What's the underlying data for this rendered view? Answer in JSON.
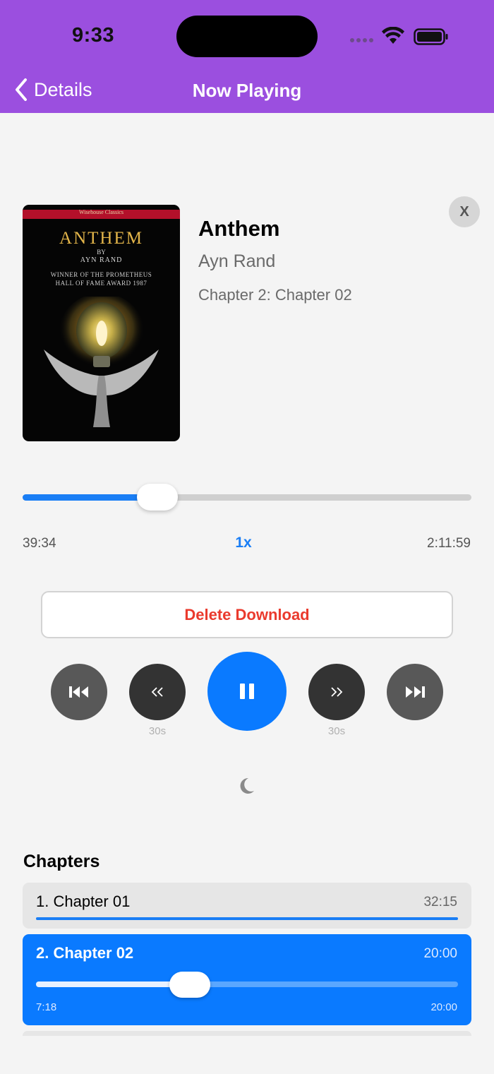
{
  "status_bar": {
    "time": "9:33"
  },
  "nav": {
    "back_label": "Details",
    "title": "Now Playing"
  },
  "book": {
    "title": "Anthem",
    "author": "Ayn Rand",
    "current_chapter": "Chapter 2: Chapter 02",
    "cover": {
      "publisher": "Wisehouse Classics",
      "title": "ANTHEM",
      "by": "BY",
      "author": "AYN RAND",
      "award": "WINNER OF THE PROMETHEUS HALL OF FAME AWARD 1987"
    },
    "close_label": "X"
  },
  "playback": {
    "elapsed": "39:34",
    "speed": "1x",
    "total": "2:11:59",
    "progress_fraction": 0.3
  },
  "actions": {
    "delete_download": "Delete Download"
  },
  "controls": {
    "skip_back_label": "30s",
    "skip_forward_label": "30s",
    "icons": [
      "previous-chapter-icon",
      "skip-back-icon",
      "pause-icon",
      "skip-forward-icon",
      "next-chapter-icon",
      "moon-icon"
    ]
  },
  "chapters": {
    "heading": "Chapters",
    "items": [
      {
        "name": "1. Chapter 01",
        "duration": "32:15",
        "progress_fraction": 1.0
      },
      {
        "name": "2. Chapter 02",
        "duration": "20:00",
        "elapsed": "7:18",
        "total": "20:00",
        "progress_fraction": 0.365
      }
    ]
  },
  "colors": {
    "nav": "#9b4fdf",
    "accent": "#0a7aff",
    "destructive": "#ea3a2d",
    "background": "#f4f4f4"
  }
}
